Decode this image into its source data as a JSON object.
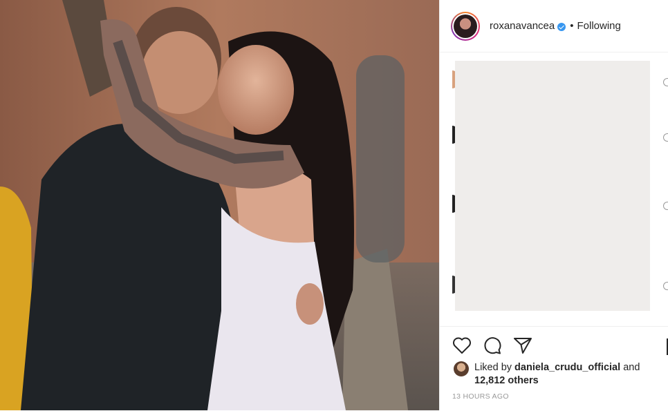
{
  "post": {
    "image_alt": "photo of a couple embracing outdoors"
  },
  "header": {
    "username": "roxanavancea",
    "separator": "•",
    "follow_status": "Following"
  },
  "likes": {
    "prefix": "Liked by",
    "liker": "daniela_crudu_official",
    "and": "and",
    "others": "12,812 others"
  },
  "timestamp": "13 HOURS AGO",
  "icons": {
    "like": "heart-icon",
    "comment": "comment-icon",
    "share": "share-icon",
    "verified": "verified-badge-icon"
  },
  "colors": {
    "verified_blue": "#3897f0",
    "text": "#262626",
    "muted": "#999999",
    "border": "#efefef"
  }
}
